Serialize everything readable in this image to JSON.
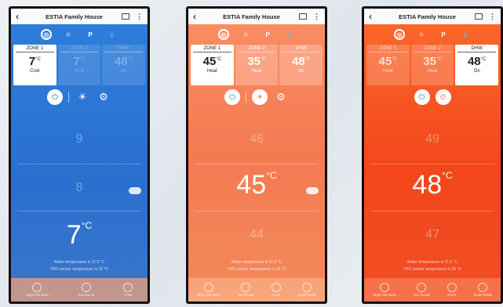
{
  "app_title": "ESTIA Family House",
  "screens": [
    {
      "zones": [
        {
          "label": "ZONE 1",
          "temp": "7",
          "mode": "Cool"
        },
        {
          "label": "ZONE 2",
          "temp": "7",
          "mode": "Cool"
        },
        {
          "label": "DHW",
          "temp": "48",
          "mode": "On"
        }
      ],
      "scale": {
        "upper": "9",
        "middle": "8",
        "current": "7"
      },
      "water_temp": "Water temperature is 21.5 °C",
      "tho_temp": "THO sensor temperature is 25 °C",
      "bottom": [
        "Night Set Back",
        "Sun Boost",
        "Frost"
      ]
    },
    {
      "zones": [
        {
          "label": "ZONE 1",
          "temp": "45",
          "mode": "Heat"
        },
        {
          "label": "ZONE 2",
          "temp": "35",
          "mode": "Heat"
        },
        {
          "label": "DHW",
          "temp": "48",
          "mode": "On"
        }
      ],
      "scale": {
        "upper": "46",
        "current": "45",
        "lower": "44"
      },
      "water_temp": "Water temperature is 21.5 °C",
      "tho_temp": "THO sensor temperature is 25 °C",
      "bottom": [
        "Night Set Back",
        "Sun Boost",
        "Frost",
        "Quiet Mode"
      ]
    },
    {
      "zones": [
        {
          "label": "ZONE 1",
          "temp": "45",
          "mode": "Heat"
        },
        {
          "label": "ZONE 2",
          "temp": "35",
          "mode": "Heat"
        },
        {
          "label": "DHW",
          "temp": "48",
          "mode": "On"
        }
      ],
      "scale": {
        "upper": "49",
        "current": "48",
        "lower": "47"
      },
      "water_temp": "Water temperature is 21.5 °C",
      "tho_temp": "THO sensor temperature is 25 °C",
      "bottom": [
        "Night Set Back",
        "Sun Boost",
        "Frost",
        "Quiet Mode"
      ]
    }
  ],
  "unit_label": "°C",
  "icons": {
    "back": "chevron-left-icon",
    "calendar": "calendar-icon",
    "menu": "more-vertical-icon",
    "power": "power-icon",
    "sun": "sun-icon",
    "gear": "gear-icon"
  }
}
